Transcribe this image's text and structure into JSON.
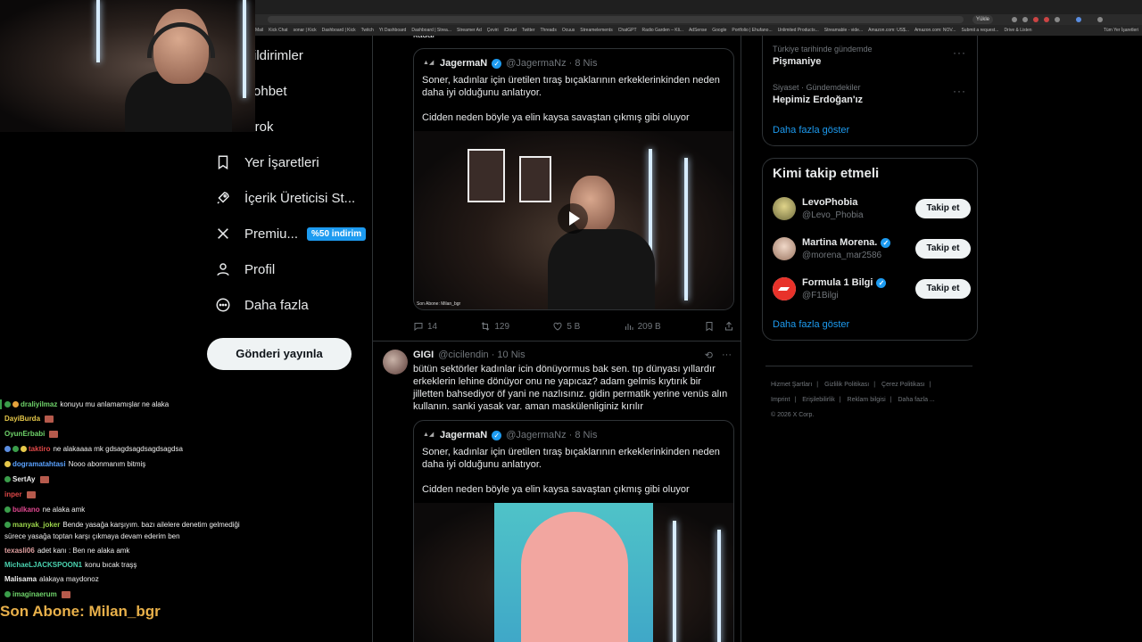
{
  "browser": {
    "update_label": "Yükle",
    "bookmarks": [
      "Mail",
      "Kick Chat",
      "sonar | Kick",
      "Dashboard | Kick",
      "Twitch",
      "Yt Dashboard",
      "Dashboard | Strea...",
      "Streamer Ad",
      "Çeviri",
      "iCloud",
      "Twitter",
      "Threads",
      "Ocuus",
      "Streamelements",
      "ChatGPT",
      "Radio Garden – Kli...",
      "AdSense",
      "Google",
      "Portfolio | Ehufano...",
      "Unlimited Products...",
      "Streamable - vide...",
      "Amazon.com: US$...",
      "Amazon.com: NOV...",
      "Submit a request..."
    ],
    "bookmarks_right": [
      "Drive & Listen",
      "Tüm Yer İşaretleri"
    ]
  },
  "nav": {
    "items": [
      {
        "label": "Bildirimler",
        "icon": "bell-icon"
      },
      {
        "label": "Sohbet",
        "icon": "chat-icon"
      },
      {
        "label": "Grok",
        "icon": "grok-icon"
      },
      {
        "label": "Yer İşaretleri",
        "icon": "bookmark-icon"
      },
      {
        "label": "İçerik Üreticisi St...",
        "icon": "rocket-icon"
      },
      {
        "label": "Premiu...",
        "icon": "x-logo-icon",
        "badge": "%50 indirim"
      },
      {
        "label": "Profil",
        "icon": "person-icon"
      },
      {
        "label": "Daha fazla",
        "icon": "more-circle-icon"
      }
    ],
    "post_button": "Gönderi yayınla"
  },
  "timeline": {
    "top_partial": "kadar",
    "tweet1": {
      "quote_name": "JagermaN",
      "quote_handle": "@JagermaNz · 8 Nis",
      "quote_text_1": "Soner, kadınlar için üretilen tıraş bıçaklarının erkeklerinkinden neden daha iyi olduğunu anlatıyor.",
      "quote_text_2": "Cidden neden böyle ya elin kaysa savaştan çıkmış gibi oluyor",
      "video_caption": "Son Abone: Milan_bgr",
      "replies": "14",
      "reposts": "129",
      "likes": "5 B",
      "views": "209 B"
    },
    "tweet2": {
      "name": "GIGI",
      "handle": "@cicilendin · 10 Nis",
      "text": "bütün sektörler kadınlar icin dönüyormus bak sen. tıp dünyası yıllardır erkeklerin lehine dönüyor onu ne yapıcaz? adam gelmis kıytırık bir jilletten bahsediyor öf yani ne nazlısınız. gidin permatik yerine venüs alın kullanın. sanki yasak var. aman maskülenliginiz kırılır",
      "quote_name": "JagermaN",
      "quote_handle": "@JagermaNz · 8 Nis",
      "quote_text_1": "Soner, kadınlar için üretilen tıraş bıçaklarının erkeklerinkinden neden daha iyi olduğunu anlatıyor.",
      "quote_text_2": "Cidden neden böyle ya elin kaysa savaştan çıkmış gibi oluyor"
    }
  },
  "trends": {
    "items": [
      {
        "meta": "Türkiye tarihinde gündemde",
        "topic": "Pişmaniye"
      },
      {
        "meta": "Siyaset · Gündemdekiler",
        "topic": "Hepimiz Erdoğan'ız"
      }
    ],
    "show_more": "Daha fazla göster"
  },
  "who_to_follow": {
    "title": "Kimi takip etmeli",
    "users": [
      {
        "name": "LevoPhobia",
        "handle": "@Levo_Phobia",
        "verified": false,
        "button": "Takip et",
        "avatar_color": "#c9c07a"
      },
      {
        "name": "Martina Morena.",
        "handle": "@morena_mar2586",
        "verified": true,
        "button": "Takip et",
        "avatar_color": "#d9b9a6"
      },
      {
        "name": "Formula 1 Bilgi",
        "handle": "@F1Bilgi",
        "verified": true,
        "button": "Takip et",
        "avatar_color": "#e8322a"
      }
    ],
    "show_more": "Daha fazla göster"
  },
  "footer": {
    "links": [
      "Hizmet Şartları",
      "Gizlilik Politikası",
      "Çerez Politikası",
      "Imprint",
      "Erişilebilirlik",
      "Reklam bilgisi",
      "Daha fazla ..."
    ],
    "copyright": "© 2026 X Corp."
  },
  "chat": {
    "messages": [
      {
        "user": "draliyilmaz",
        "text": "konuyu mu anlamamışlar ne alaka",
        "color": "#6fd36a"
      },
      {
        "user": "DayiBurda",
        "text": "",
        "color": "#e6c84a"
      },
      {
        "user": "OyunErbabi",
        "text": "",
        "color": "#6fd36a"
      },
      {
        "user": "taktiro",
        "text": "ne alakaaaa mk gdsagdsagdsagdsagdsa",
        "color": "#e04848"
      },
      {
        "user": "dogramatahtasi",
        "text": "Nooo abonmanım bitmiş",
        "color": "#5aa2ff"
      },
      {
        "user": "SertAy",
        "text": "",
        "color": "#f0f0f0"
      },
      {
        "user": "inper",
        "text": "",
        "color": "#e04848"
      },
      {
        "user": "bulkano",
        "text": "ne alaka amk",
        "color": "#e04890"
      },
      {
        "user": "manyak_joker",
        "text": "Bende yasağa karşıyım. bazı ailelere denetim gelmediği",
        "color": "#9ad34a"
      },
      {
        "user": "",
        "text": "sürece yasağa toptan karşı çıkmaya devam ederim ben",
        "color": "#f0f0f0"
      },
      {
        "user": "texasli06",
        "text": "adet kanı : Ben ne alaka amk",
        "color": "#e0a0a0"
      },
      {
        "user": "MichaeLJACKSPOON1",
        "text": "konu bıcak traşş",
        "color": "#4ad3b0"
      },
      {
        "user": "Malisama",
        "text": "alakaya maydonoz",
        "color": "#f0f0f0"
      },
      {
        "user": "imaginaerum",
        "text": "",
        "color": "#6fd36a"
      }
    ],
    "sub_banner": "Son Abone: Milan_bgr"
  }
}
